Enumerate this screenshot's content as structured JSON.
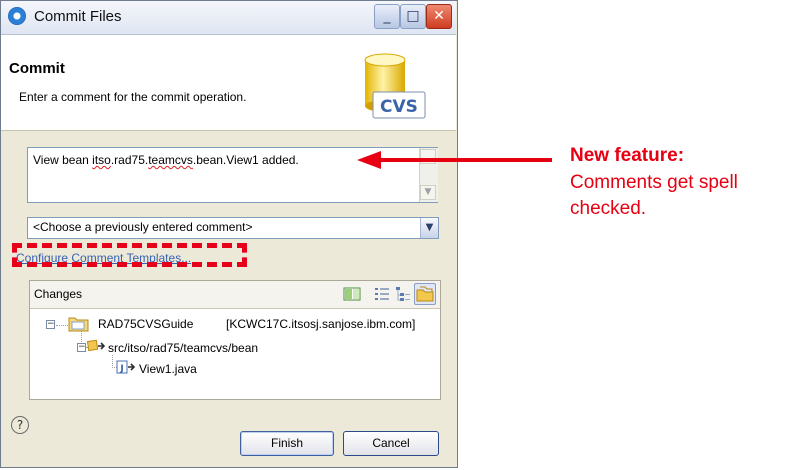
{
  "window": {
    "title": "Commit Files",
    "controls": {
      "minimize": "_",
      "maximize": "□",
      "close": "✕"
    }
  },
  "header": {
    "title": "Commit",
    "description": "Enter a comment for the commit operation.",
    "logo_text": "CVS"
  },
  "comment": {
    "text_parts": [
      "View bean ",
      "itso",
      ".rad75.",
      "teamcvs",
      ".bean.View1 added."
    ],
    "misspelled": [
      "itso",
      "teamcvs"
    ]
  },
  "previous_comments": {
    "selected": "<Choose a previously entered comment>"
  },
  "configure_link": "Configure Comment Templates...",
  "changes": {
    "label": "Changes",
    "tree": {
      "project": "RAD75CVSGuide",
      "repository": "[KCWC17C.itsosj.sanjose.ibm.com]",
      "package": "src/itso/rad75/teamcvs/bean",
      "file": "View1.java"
    }
  },
  "buttons": {
    "finish": "Finish",
    "cancel": "Cancel",
    "help": "?"
  },
  "annotation": {
    "title": "New feature:",
    "body": "Comments get spell checked."
  },
  "colors": {
    "annotation_red": "#e60012",
    "link_blue": "#3a62b3",
    "dialog_bg": "#ece9d8"
  }
}
